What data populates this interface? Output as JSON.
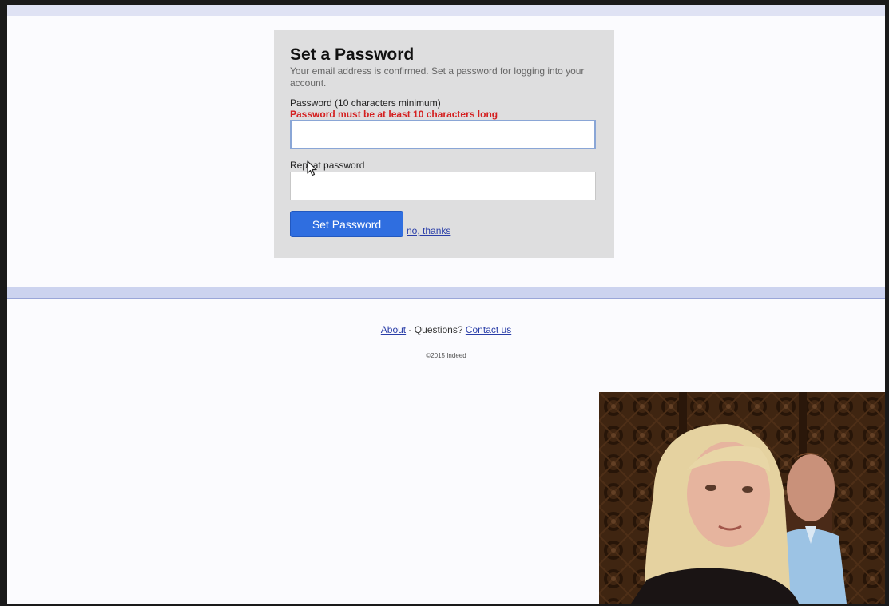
{
  "card": {
    "title": "Set a Password",
    "description": "Your email address is confirmed. Set a password for logging into your account.",
    "password_label": "Password (10 characters minimum)",
    "password_error": "Password must be at least 10 characters long",
    "password_value": "",
    "repeat_label": "Repeat password",
    "repeat_value": "",
    "submit_label": "Set Password",
    "decline_label": "no, thanks"
  },
  "footer": {
    "about_label": "About",
    "separator": " - Questions? ",
    "contact_label": "Contact us",
    "copyright": "©2015 Indeed"
  },
  "colors": {
    "error": "#d42020",
    "primary_button": "#2f6ee0",
    "link": "#2a3ea8",
    "band": "#dfe2f4"
  },
  "icons": {
    "cursor": "mouse-pointer-icon"
  },
  "webcam": {
    "description_icon": "video-overlay"
  }
}
